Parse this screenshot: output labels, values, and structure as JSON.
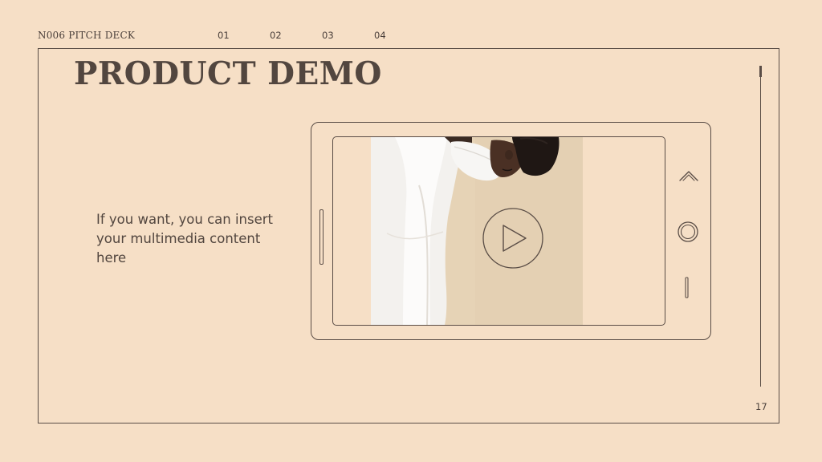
{
  "header": {
    "deck_label": "N006 PITCH DECK",
    "nav": [
      {
        "label": "01"
      },
      {
        "label": "02"
      },
      {
        "label": "03"
      },
      {
        "label": "04"
      }
    ]
  },
  "slide": {
    "title": "PRODUCT DEMO",
    "body": "If you want, you can insert your multimedia content here",
    "page_number": "17"
  },
  "phone": {
    "icons": {
      "up": "chevron-up-icon",
      "home": "home-circle-icon",
      "menu": "menu-bar-icon",
      "play": "play-icon"
    }
  },
  "colors": {
    "background": "#f6dfc6",
    "line": "#5a4d46",
    "text": "#52463f",
    "video_backdrop": "#e6d3b6"
  }
}
